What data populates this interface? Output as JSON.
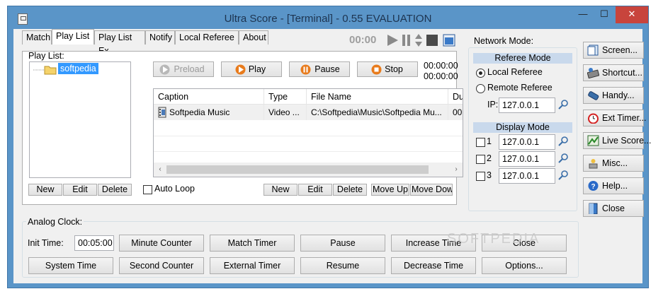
{
  "window": {
    "title": "Ultra Score - [Terminal] - 0.55 EVALUATION",
    "min": "—",
    "max": "☐",
    "close": "✕"
  },
  "tabs": [
    "Match",
    "Play List",
    "Play List Ex",
    "Notify",
    "Local Referee",
    "About"
  ],
  "media": {
    "time": "00:00"
  },
  "playlist": {
    "label": "Play List:",
    "tree_item": "softpedia",
    "buttons": {
      "preload": "Preload",
      "play": "Play",
      "pause": "Pause",
      "stop": "Stop"
    },
    "time1": "00:00:00",
    "time2": "00:00:00",
    "columns": [
      "Caption",
      "Type",
      "File Name",
      "Du"
    ],
    "rows": [
      {
        "caption": "Softpedia Music",
        "type": "Video ...",
        "file": "C:\\Softpedia\\Music\\Softpedia Mu...",
        "dur": "00"
      }
    ],
    "left_buttons": [
      "New",
      "Edit",
      "Delete"
    ],
    "auto_loop": "Auto Loop",
    "right_buttons": [
      "New",
      "Edit",
      "Delete",
      "Move Up",
      "Move Down"
    ]
  },
  "analog": {
    "label": "Analog Clock:",
    "init_label": "Init Time:",
    "init_value": "00:05:00",
    "row1": [
      "Minute Counter",
      "Match Timer",
      "Pause",
      "Increase Time",
      "Close"
    ],
    "row2": [
      "System Time",
      "Second Counter",
      "External Timer",
      "Resume",
      "Decrease Time",
      "Options..."
    ]
  },
  "network": {
    "label": "Network Mode:",
    "referee_header": "Referee Mode",
    "local": "Local Referee",
    "remote": "Remote Referee",
    "ip_label": "IP:",
    "ip": "127.0.0.1",
    "display_header": "Display Mode",
    "displays": [
      {
        "n": "1",
        "ip": "127.0.0.1"
      },
      {
        "n": "2",
        "ip": "127.0.0.1"
      },
      {
        "n": "3",
        "ip": "127.0.0.1"
      }
    ]
  },
  "side_buttons": [
    "Screen...",
    "Shortcut...",
    "Handy...",
    "Ext Timer...",
    "Live Score...",
    "Misc...",
    "Help...",
    "Close"
  ],
  "watermark": "SOFTPEDIA"
}
